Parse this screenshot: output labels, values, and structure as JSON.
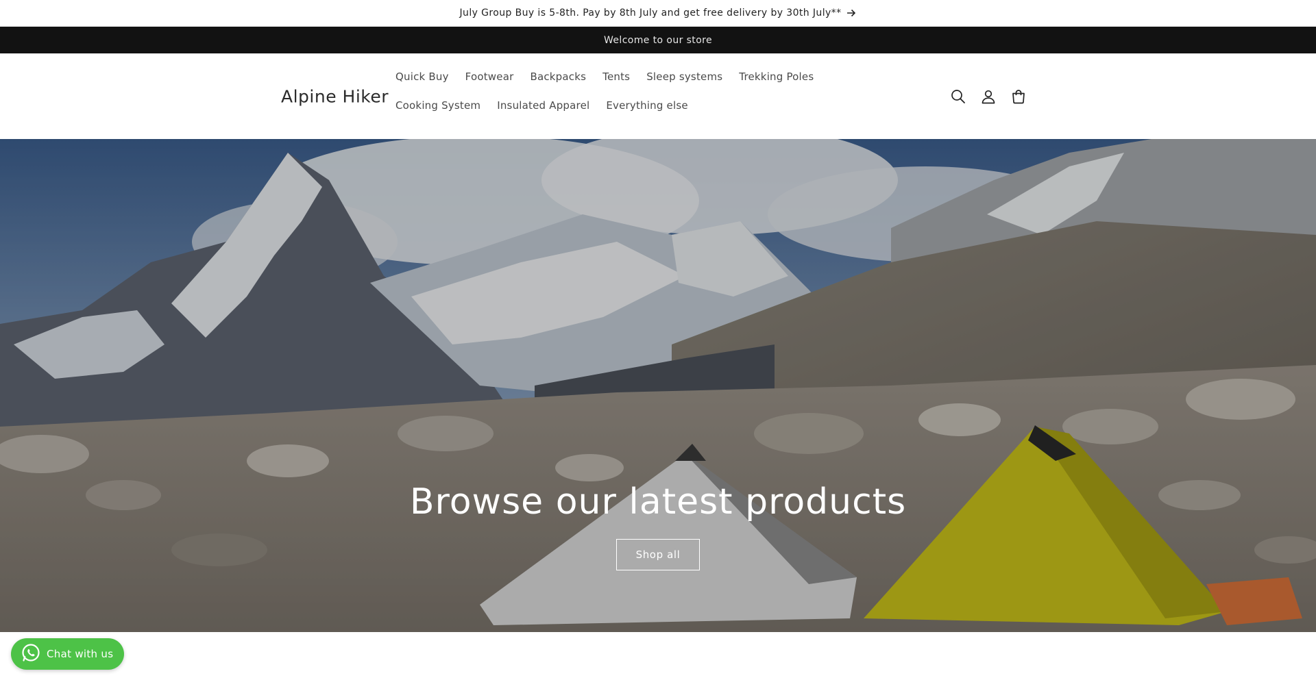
{
  "announcement": {
    "text": "July Group Buy is 5-8th. Pay by 8th July and get free delivery by 30th July**",
    "icon": "arrow-right-icon"
  },
  "welcome_bar": {
    "text": "Welcome to our store"
  },
  "header": {
    "logo": "Alpine Hiker",
    "nav": [
      {
        "label": "Quick Buy"
      },
      {
        "label": "Footwear"
      },
      {
        "label": "Backpacks"
      },
      {
        "label": "Tents"
      },
      {
        "label": "Sleep systems"
      },
      {
        "label": "Trekking Poles"
      },
      {
        "label": "Cooking System"
      },
      {
        "label": "Insulated Apparel"
      },
      {
        "label": "Everything else"
      }
    ],
    "icons": [
      "search-icon",
      "account-icon",
      "cart-icon"
    ]
  },
  "hero": {
    "title": "Browse our latest products",
    "button_label": "Shop all"
  },
  "chat_widget": {
    "label": "Chat with us",
    "icon": "whatsapp-icon",
    "color": "#4dc247"
  },
  "colors": {
    "welcome_bar_bg": "#121212",
    "tent_yellow": "#c9c21a"
  }
}
